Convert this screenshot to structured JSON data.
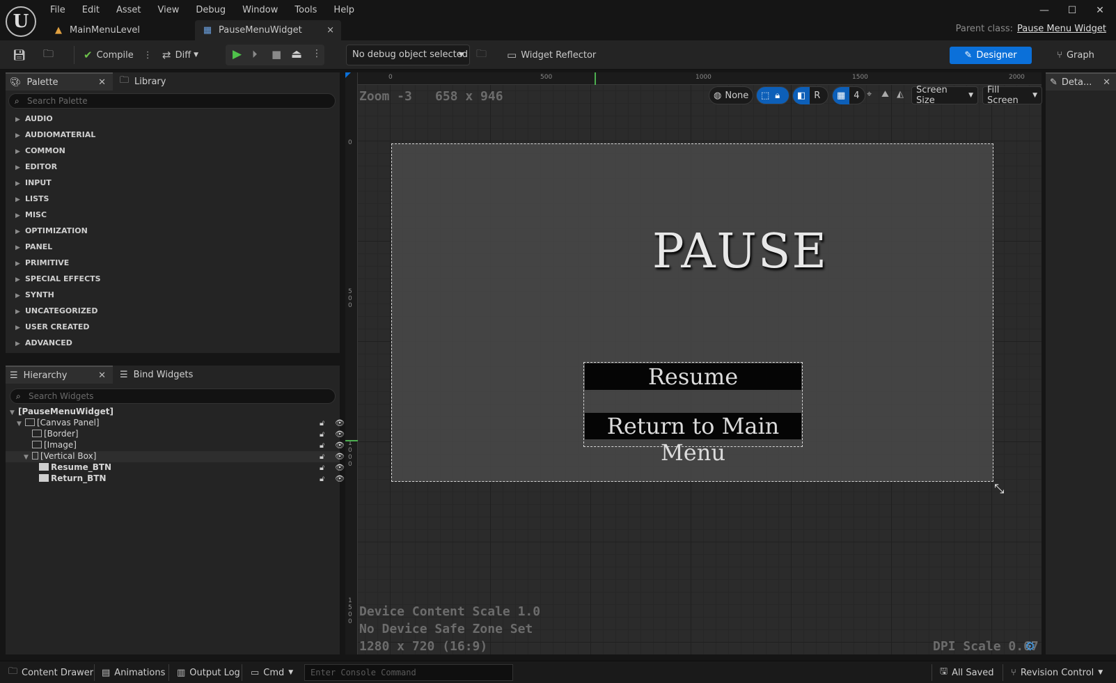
{
  "app": {
    "logo_glyph": "U",
    "menu": [
      "File",
      "Edit",
      "Asset",
      "View",
      "Debug",
      "Window",
      "Tools",
      "Help"
    ],
    "tabs": [
      {
        "label": "MainMenuLevel",
        "icon": "level-icon"
      },
      {
        "label": "PauseMenuWidget",
        "icon": "widget-blueprint-icon",
        "close": "×"
      }
    ],
    "parent_class_label": "Parent class:",
    "parent_class_value": "Pause Menu Widget",
    "window_controls": {
      "minimize": "—",
      "maximize": "☐",
      "close": "✕"
    }
  },
  "toolbar": {
    "compile_label": "Compile",
    "diff_label": "Diff",
    "debug_object": "No debug object selected",
    "widget_reflector_label": "Widget Reflector",
    "designer_label": "Designer",
    "graph_label": "Graph",
    "accent_color": "#0b70d9"
  },
  "palette": {
    "tab_label": "Palette",
    "library_tab_label": "Library",
    "search_placeholder": "Search Palette",
    "categories": [
      "AUDIO",
      "AUDIOMATERIAL",
      "COMMON",
      "EDITOR",
      "INPUT",
      "LISTS",
      "MISC",
      "OPTIMIZATION",
      "PANEL",
      "PRIMITIVE",
      "SPECIAL EFFECTS",
      "SYNTH",
      "UNCATEGORIZED",
      "USER CREATED",
      "ADVANCED"
    ]
  },
  "hierarchy": {
    "tab_label": "Hierarchy",
    "bind_tab_label": "Bind Widgets",
    "search_placeholder": "Search Widgets",
    "nodes": [
      {
        "label": "[PauseMenuWidget]",
        "bold": true
      },
      {
        "label": "[Canvas Panel]"
      },
      {
        "label": "[Border]"
      },
      {
        "label": "[Image]"
      },
      {
        "label": "[Vertical Box]"
      },
      {
        "label": "Resume_BTN",
        "bold": true
      },
      {
        "label": "Return_BTN",
        "bold": true
      }
    ]
  },
  "viewport": {
    "zoom": "Zoom -3",
    "size": "658 x 946",
    "ruler_top": [
      "0",
      "500",
      "1000",
      "1500",
      "2000"
    ],
    "ruler_left": [
      "0",
      "500",
      "1000",
      "1500"
    ],
    "none_label": "None",
    "r_label": "R",
    "grid_count": "4",
    "screen_size_label": "Screen Size",
    "fill_screen_label": "Fill Screen",
    "device_scale": "Device Content Scale 1.0",
    "safe_zone": "No Device Safe Zone Set",
    "resolution": "1280 x 720 (16:9)",
    "dpi_scale": "DPI Scale 0.67"
  },
  "widget": {
    "title": "PAUSE",
    "resume_label": "Resume",
    "return_label": "Return to Main Menu"
  },
  "details": {
    "tab_label": "Deta..."
  },
  "statusbar": {
    "content_drawer": "Content Drawer",
    "animations": "Animations",
    "output_log": "Output Log",
    "cmd": "Cmd",
    "console_placeholder": "Enter Console Command",
    "all_saved": "All Saved",
    "revision_control": "Revision Control"
  }
}
